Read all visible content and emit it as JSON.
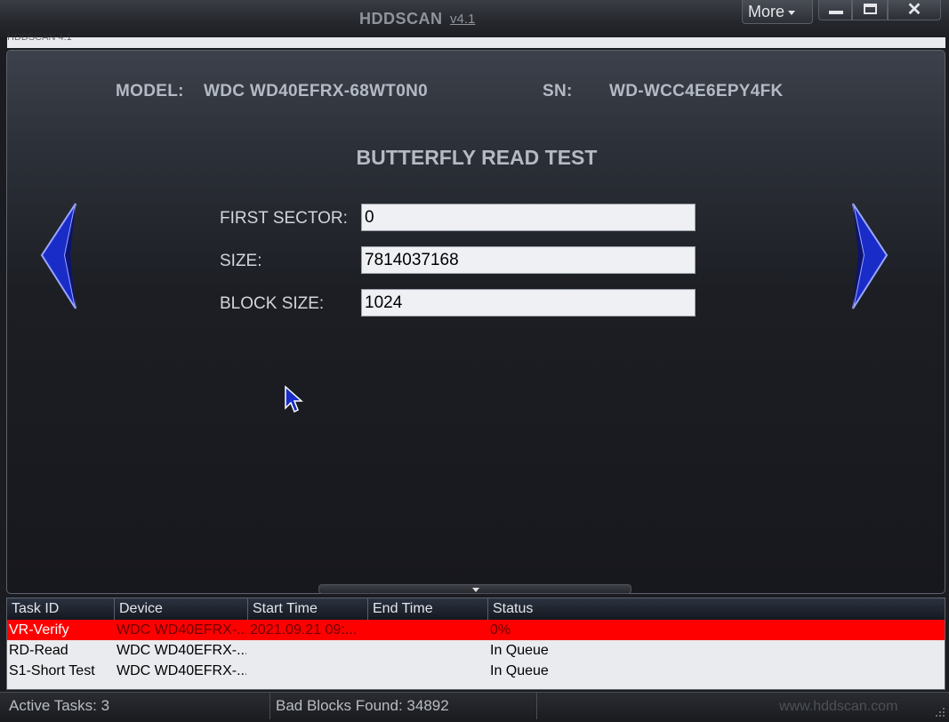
{
  "window": {
    "title": "HDDSCAN",
    "version": "v4.1",
    "subtitle": "HDDSCAN 4.1"
  },
  "titlebar": {
    "more_label": "More"
  },
  "drive": {
    "model_label": "MODEL:",
    "model": "WDC WD40EFRX-68WT0N0",
    "sn_label": "SN:",
    "sn": "WD-WCC4E6EPY4FK"
  },
  "test": {
    "title": "BUTTERFLY READ TEST",
    "fields": [
      {
        "label": "FIRST SECTOR:",
        "value": "0"
      },
      {
        "label": "SIZE:",
        "value": "7814037168"
      },
      {
        "label": "BLOCK SIZE:",
        "value": "1024"
      }
    ]
  },
  "tasks": {
    "columns": [
      "Task ID",
      "Device",
      "Start Time",
      "End Time",
      "Status"
    ],
    "rows": [
      {
        "id": "VR-Verify",
        "device": "WDC WD40EFRX-...",
        "start": "2021.09.21 09:...",
        "end": "",
        "status": "0%",
        "selected": true
      },
      {
        "id": "RD-Read",
        "device": "WDC WD40EFRX-...",
        "start": "",
        "end": "",
        "status": "In Queue",
        "selected": false
      },
      {
        "id": "S1-Short Test",
        "device": "WDC WD40EFRX-...",
        "start": "",
        "end": "",
        "status": "In Queue",
        "selected": false
      }
    ]
  },
  "status": {
    "active_tasks": "Active Tasks: 3",
    "bad_blocks": "Bad Blocks Found: 34892",
    "website": "www.hddscan.com"
  },
  "colors": {
    "selected_row": "#ff0000",
    "arrow": "#1a2cc8"
  }
}
